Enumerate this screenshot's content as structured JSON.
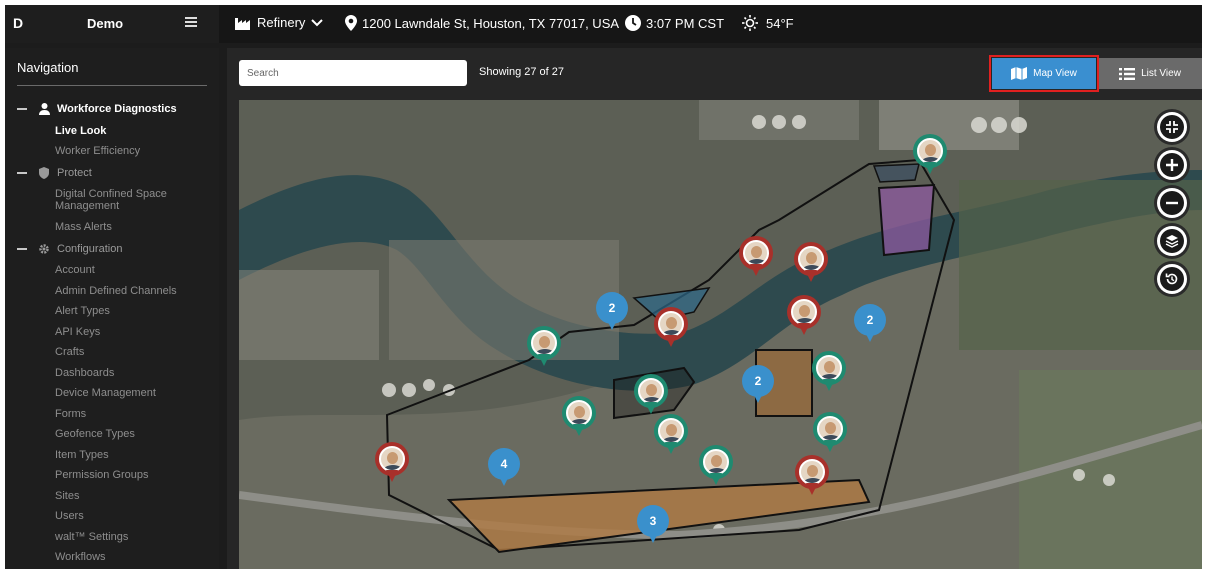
{
  "brand": {
    "logo": "D",
    "name": "Demo"
  },
  "topbar": {
    "site": "Refinery",
    "address": "1200 Lawndale St, Houston, TX 77017, USA",
    "time": "3:07 PM CST",
    "temperature": "54°F"
  },
  "sidebar": {
    "title": "Navigation",
    "sections": [
      {
        "label": "Workforce Diagnostics",
        "icon": "person-icon",
        "active": true,
        "items": [
          "Live Look",
          "Worker Efficiency"
        ]
      },
      {
        "label": "Protect",
        "icon": "shield-icon",
        "active": false,
        "items": [
          "Digital Confined Space Management",
          "Mass Alerts"
        ]
      },
      {
        "label": "Configuration",
        "icon": "gear-icon",
        "active": false,
        "items": [
          "Account",
          "Admin Defined Channels",
          "Alert Types",
          "API Keys",
          "Crafts",
          "Dashboards",
          "Device Management",
          "Forms",
          "Geofence Types",
          "Item Types",
          "Permission Groups",
          "Sites",
          "Users",
          "walt™ Settings",
          "Workflows"
        ]
      }
    ],
    "active_item": "Live Look"
  },
  "toolbar": {
    "search_placeholder": "Search",
    "showing": "Showing 27 of 27",
    "map_view_label": "Map View",
    "list_view_label": "List View"
  },
  "map": {
    "clusters": [
      "2",
      "2",
      "2",
      "4",
      "3"
    ],
    "controls": [
      "fullscreen-exit-icon",
      "zoom-in-icon",
      "zoom-out-icon",
      "layers-icon",
      "history-icon"
    ],
    "colors": {
      "cluster": "#3a90cc",
      "ok_worker": "#1f8a70",
      "alert_worker": "#a8302a",
      "accent_blue": "#3a8fd0",
      "highlight": "#e02020"
    }
  }
}
